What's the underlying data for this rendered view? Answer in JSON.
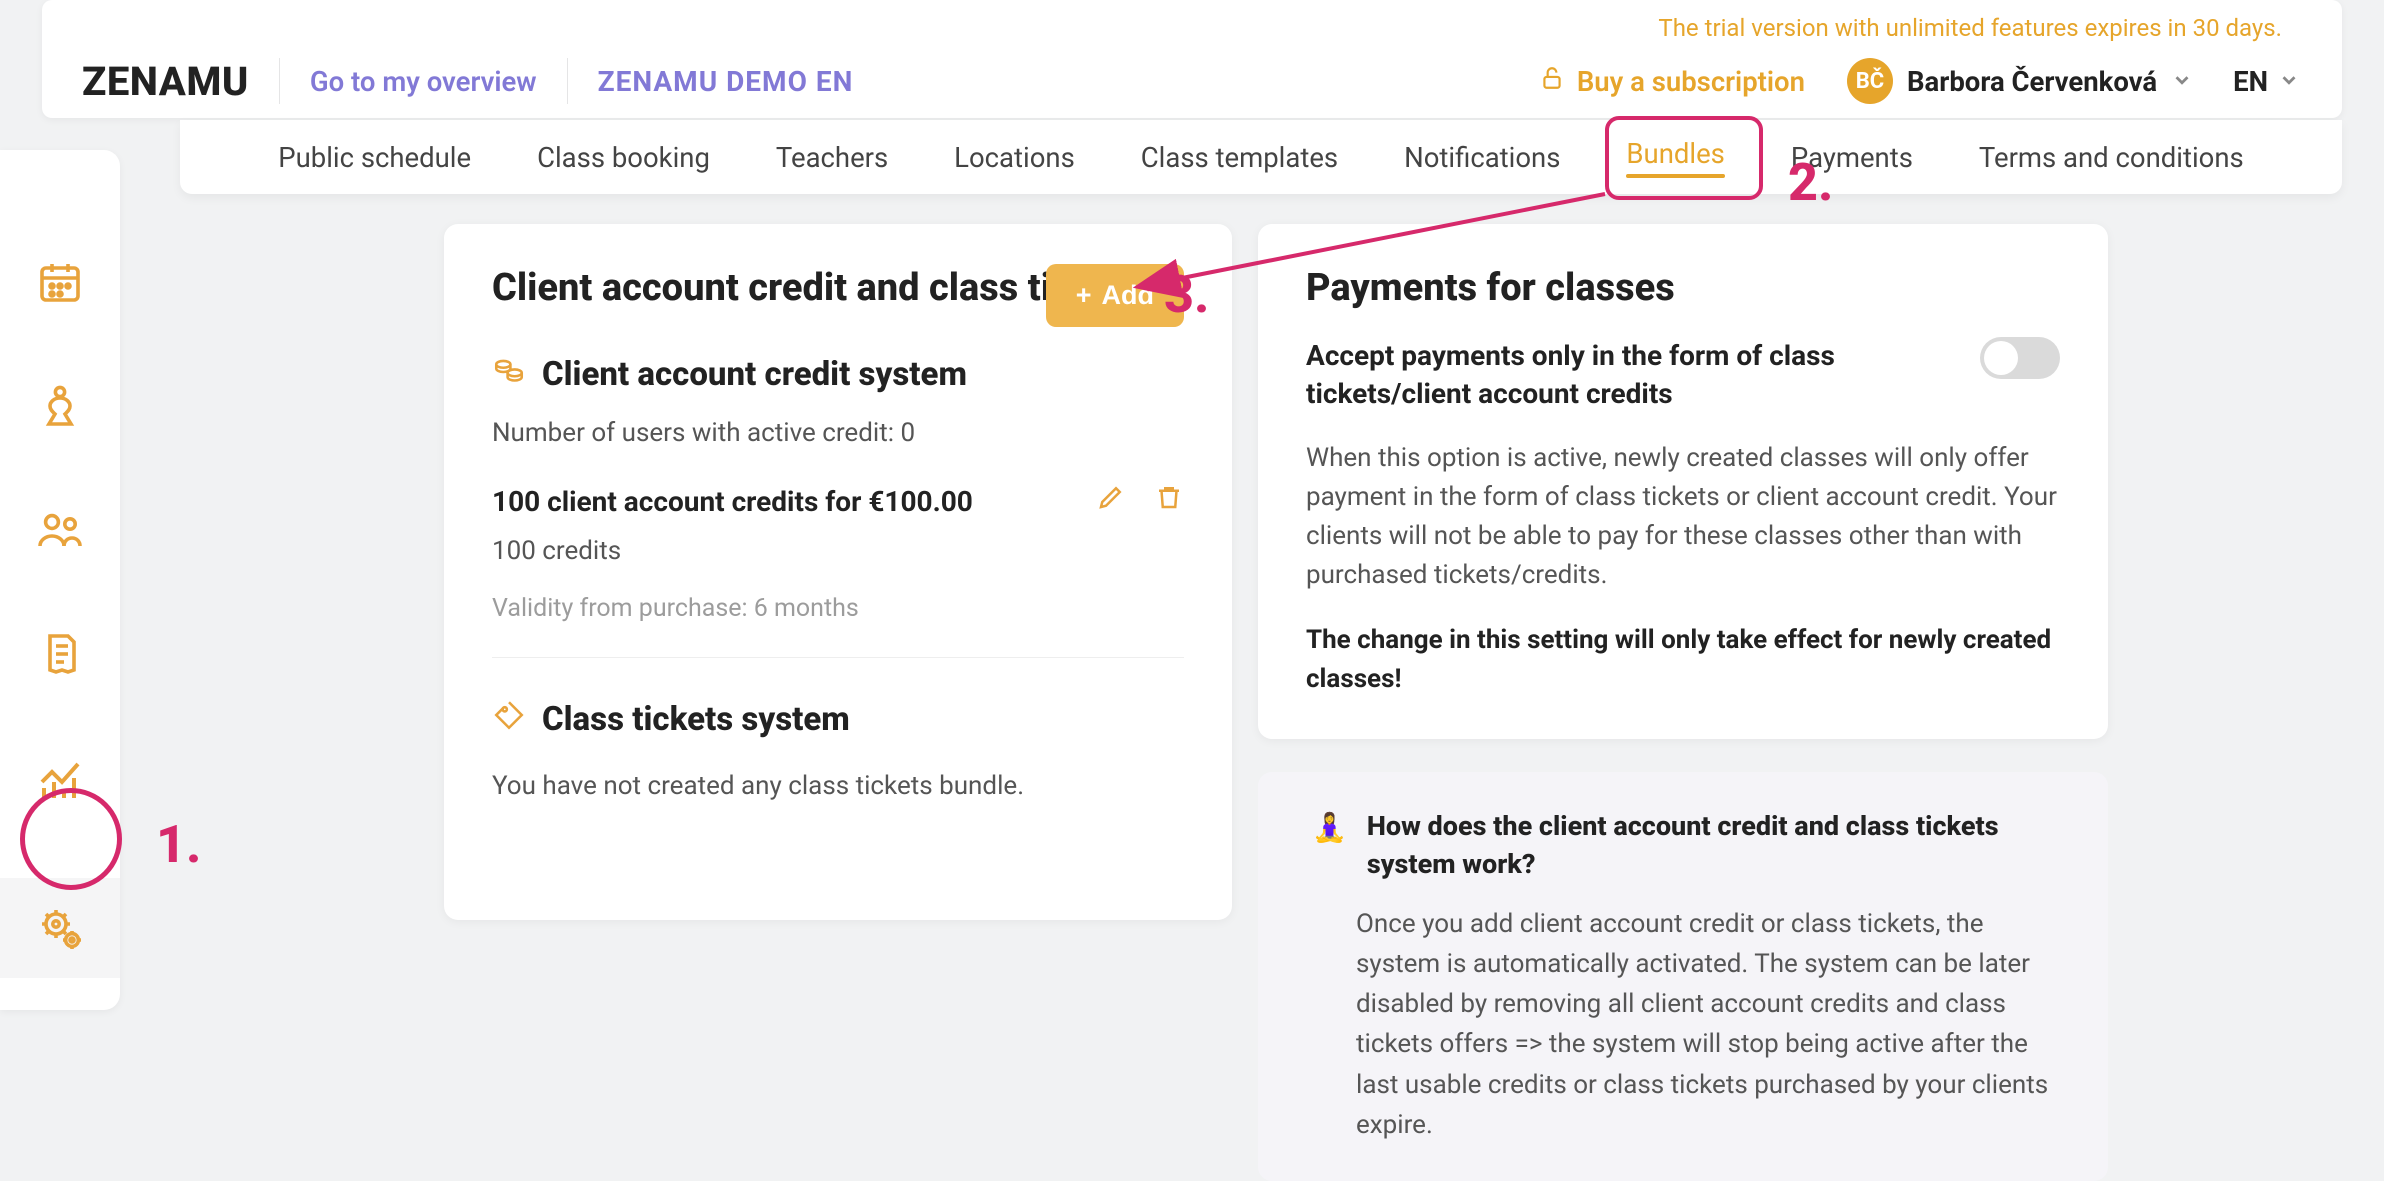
{
  "header": {
    "trial_text": "The trial version with unlimited features expires in 30 days.",
    "logo_text": "ZENAMU",
    "go_overview": "Go to my overview",
    "demo": "ZENAMU DEMO EN",
    "buy_subscription": "Buy a subscription",
    "user": {
      "initials": "BČ",
      "name": "Barbora Červenková"
    },
    "lang": "EN"
  },
  "tabs": {
    "items": [
      "Public schedule",
      "Class booking",
      "Teachers",
      "Locations",
      "Class templates",
      "Notifications",
      "Bundles",
      "Payments",
      "Terms and conditions"
    ],
    "active_index": 6
  },
  "left_card": {
    "title": "Client account credit and class tickets",
    "add_label": "Add",
    "credit_section_title": "Client account credit system",
    "users_active_credit": "Number of users with active credit: 0",
    "credit_offer_title": "100 client account credits for €100.00",
    "credit_offer_detail": "100 credits",
    "credit_validity": "Validity from purchase: 6 months",
    "tickets_section_title": "Class tickets system",
    "tickets_empty": "You have not created any class tickets bundle."
  },
  "right_card": {
    "title": "Payments for classes",
    "toggle_label": "Accept payments only in the form of class tickets/client account credits",
    "description": "When this option is active, newly created classes will only offer payment in the form of class tickets or client account credit. Your clients will not be able to pay for these classes other than with purchased tickets/credits.",
    "warning": "The change in this setting will only take effect for newly created classes!"
  },
  "info_box": {
    "title": "How does the client account credit and class tickets system work?",
    "body": "Once you add client account credit or class tickets, the system is automatically activated. The system can be later disabled by removing all client account credits and class tickets offers => the system will stop being active after the last usable credits or class tickets purchased by your clients expire."
  },
  "annotations": {
    "n1": "1.",
    "n2": "2.",
    "n3": "3."
  }
}
